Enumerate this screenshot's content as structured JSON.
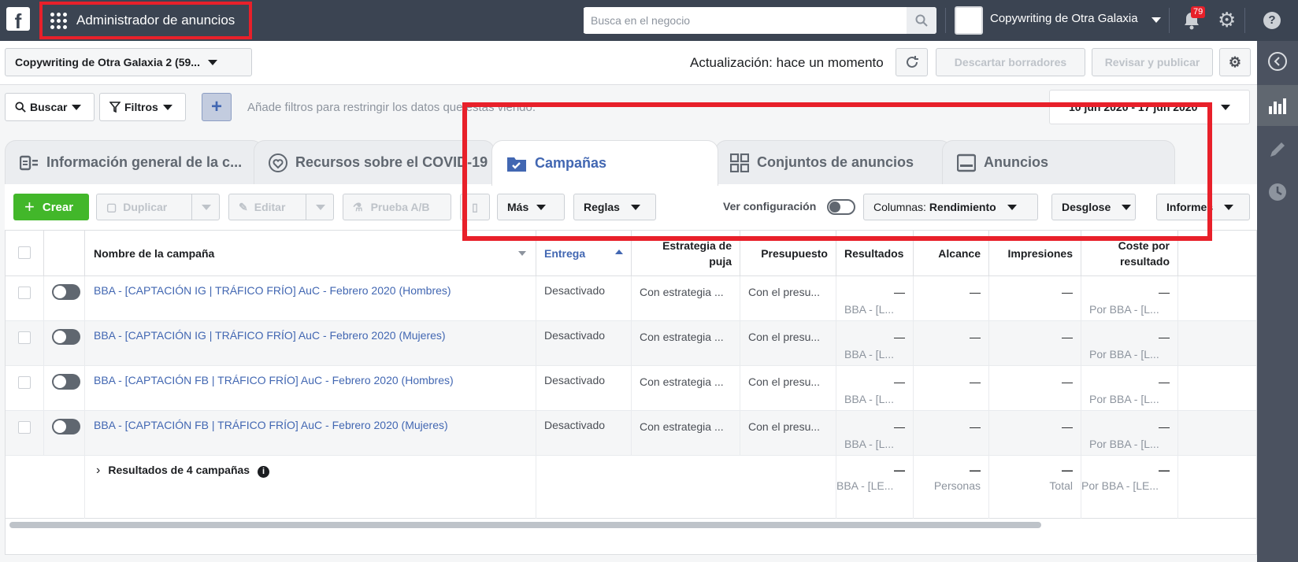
{
  "topbar": {
    "app_title": "Administrador de anuncios",
    "search_placeholder": "Busca en el negocio",
    "account_name": "Copywriting de Otra Galaxia",
    "notifications_count": "79"
  },
  "account_bar": {
    "account_selector": "Copywriting de Otra Galaxia 2 (59...",
    "updated_text": "Actualización: hace un momento",
    "discard_label": "Descartar borradores",
    "review_label": "Revisar y publicar"
  },
  "filter_bar": {
    "search_label": "Buscar",
    "filters_label": "Filtros",
    "hint": "Añade filtros para restringir los datos que estás viendo.",
    "date_range": "10 jun 2020 - 17 jun 2020"
  },
  "tabs": [
    {
      "label": "Información general de la c..."
    },
    {
      "label": "Recursos sobre el COVID-19"
    },
    {
      "label": "Campañas"
    },
    {
      "label": "Conjuntos de anuncios"
    },
    {
      "label": "Anuncios"
    }
  ],
  "toolbar": {
    "create": "Crear",
    "duplicate": "Duplicar",
    "edit": "Editar",
    "ab_test": "Prueba A/B",
    "more": "Más",
    "rules": "Reglas",
    "view_config": "Ver configuración",
    "columns_prefix": "Columnas:",
    "columns_value": "Rendimiento",
    "breakdown": "Desglose",
    "reports": "Informes"
  },
  "table": {
    "headers": {
      "name": "Nombre de la campaña",
      "delivery": "Entrega",
      "bid_line1": "Estrategia de",
      "bid_line2": "puja",
      "budget": "Presupuesto",
      "results": "Resultados",
      "reach": "Alcance",
      "impressions": "Impresiones",
      "cost_line1": "Coste por",
      "cost_line2": "resultado"
    },
    "rows": [
      {
        "name": "BBA - [CAPTACIÓN IG | TRÁFICO FRÍO] AuC - Febrero 2020 (Hombres)",
        "delivery": "Desactivado",
        "bid": "Con estrategia ...",
        "budget": "Con el presu...",
        "results": "—",
        "results_sub": "BBA - [L...",
        "reach": "—",
        "impressions": "—",
        "cost": "—",
        "cost_sub": "Por BBA - [L..."
      },
      {
        "name": "BBA - [CAPTACIÓN IG | TRÁFICO FRÍO] AuC - Febrero 2020 (Mujeres)",
        "delivery": "Desactivado",
        "bid": "Con estrategia ...",
        "budget": "Con el presu...",
        "results": "—",
        "results_sub": "BBA - [L...",
        "reach": "—",
        "impressions": "—",
        "cost": "—",
        "cost_sub": "Por BBA - [L..."
      },
      {
        "name": "BBA - [CAPTACIÓN FB | TRÁFICO FRÍO] AuC - Febrero 2020 (Hombres)",
        "delivery": "Desactivado",
        "bid": "Con estrategia ...",
        "budget": "Con el presu...",
        "results": "—",
        "results_sub": "BBA - [L...",
        "reach": "—",
        "impressions": "—",
        "cost": "—",
        "cost_sub": "Por BBA - [L..."
      },
      {
        "name": "BBA - [CAPTACIÓN FB | TRÁFICO FRÍO] AuC - Febrero 2020 (Mujeres)",
        "delivery": "Desactivado",
        "bid": "Con estrategia ...",
        "budget": "Con el presu...",
        "results": "—",
        "results_sub": "BBA - [L...",
        "reach": "—",
        "impressions": "—",
        "cost": "—",
        "cost_sub": "Por BBA - [L..."
      }
    ],
    "summary": {
      "label": "Resultados de 4 campañas",
      "results": "—",
      "results_sub": "BBA - [LE...",
      "reach": "—",
      "reach_sub": "Personas",
      "impressions": "—",
      "impressions_sub": "Total",
      "cost": "—",
      "cost_sub": "Por BBA - [LE..."
    }
  },
  "colors": {
    "topbar": "#3b4452",
    "accent_blue": "#4267b2",
    "create_green": "#42b72a",
    "highlight_red": "#e8202a"
  },
  "icons": [
    "facebook-logo-icon",
    "apps-grid-icon",
    "search-icon",
    "bell-icon",
    "gear-icon",
    "help-icon",
    "refresh-icon",
    "plus-icon",
    "funnel-icon",
    "folder-check-icon",
    "heart-icon",
    "grid-icon",
    "ad-icon",
    "info-icon",
    "chevron-right-icon",
    "collapse-icon",
    "chart-icon",
    "pencil-icon",
    "clock-icon"
  ]
}
